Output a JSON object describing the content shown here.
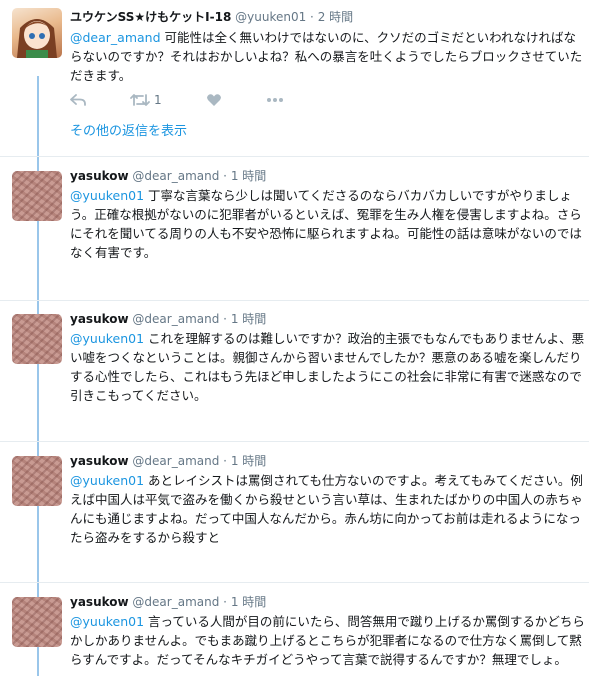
{
  "tweets": [
    {
      "name": "ユウケンSS★けもケットI-18",
      "handle": "@yuuken01",
      "time": "2 時間",
      "mention": "@dear_amand",
      "text": "可能性は全く無いわけではないのに、クソだのゴミだといわれなければならないのですか？それはおかしいよね？私への暴言を吐くようでしたらブロックさせていただきます。",
      "retweets": "1"
    },
    {
      "name": "yasukow",
      "handle": "@dear_amand",
      "time": "1 時間",
      "mention": "@yuuken01",
      "text": "丁寧な言葉なら少しは聞いてくださるのならバカバカしいですがやりましょう。正確な根拠がないのに犯罪者がいるといえば、冤罪を生み人権を侵害しますよね。さらにそれを聞いてる周りの人も不安や恐怖に駆られますよね。可能性の話は意味がないのではなく有害です。"
    },
    {
      "name": "yasukow",
      "handle": "@dear_amand",
      "time": "1 時間",
      "mention": "@yuuken01",
      "text": "これを理解するのは難しいですか？政治的主張でもなんでもありませんよ、悪い嘘をつくなということは。親御さんから習いませんでしたか？悪意のある嘘を楽しんだりする心性でしたら、これはもう先ほど申しましたようにこの社会に非常に有害で迷惑なので引きこもってください。"
    },
    {
      "name": "yasukow",
      "handle": "@dear_amand",
      "time": "1 時間",
      "mention": "@yuuken01",
      "text": "あとレイシストは罵倒されても仕方ないのですよ。考えてもみてください。例えば中国人は平気で盗みを働くから殺せという言い草は、生まれたばかりの中国人の赤ちゃんにも通じますよね。だって中国人なんだから。赤ん坊に向かってお前は走れるようになったら盗みをするから殺すと"
    },
    {
      "name": "yasukow",
      "handle": "@dear_amand",
      "time": "1 時間",
      "mention": "@yuuken01",
      "text": "言っている人間が目の前にいたら、問答無用で蹴り上げるか罵倒するかどちらかしかありませんよ。でもまあ蹴り上げるとこちらが犯罪者になるので仕方なく罵倒して黙らすんですよ。だってそんなキチガイどうやって言葉で説得するんですか？無理でしょ。"
    }
  ],
  "show_more_replies": "その他の返信を表示",
  "meta_separator": "·",
  "icons": [
    "reply-icon",
    "retweet-icon",
    "like-icon",
    "more-icon"
  ],
  "colors": {
    "link": "#1b95e0",
    "thread_line": "#9ac6ea",
    "muted": "#657786",
    "icon": "#aab8c2"
  }
}
